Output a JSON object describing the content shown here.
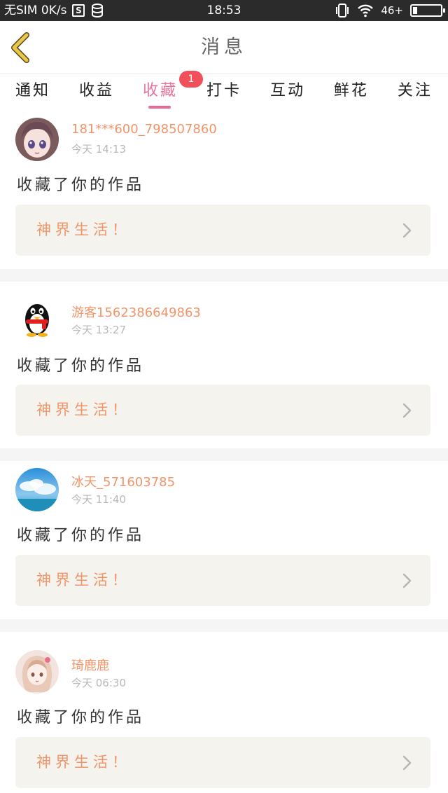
{
  "status_bar": {
    "carrier": "无SIM 0K/s",
    "time": "18:53",
    "network": "46+",
    "icons": [
      "sim-card-icon",
      "database-icon",
      "vibrate-icon",
      "wifi-icon",
      "battery-icon"
    ]
  },
  "header": {
    "title": "消息",
    "back_icon": "chevron-left-icon"
  },
  "tabs": [
    {
      "label": "通知",
      "active": false
    },
    {
      "label": "收益",
      "active": false
    },
    {
      "label": "收藏",
      "active": true,
      "badge": "1"
    },
    {
      "label": "打卡",
      "active": false
    },
    {
      "label": "互动",
      "active": false
    },
    {
      "label": "鲜花",
      "active": false
    },
    {
      "label": "关注",
      "active": false
    }
  ],
  "messages": [
    {
      "username": "181***600_798507860",
      "time": "今天 14:13",
      "action": "收藏了你的作品",
      "work_title": "神界生活！",
      "avatar": "anime-girl-avatar"
    },
    {
      "username": "游客1562386649863",
      "time": "今天 13:27",
      "action": "收藏了你的作品",
      "work_title": "神界生活！",
      "avatar": "penguin-avatar"
    },
    {
      "username": "冰天_571603785",
      "time": "今天 11:40",
      "action": "收藏了你的作品",
      "work_title": "神界生活！",
      "avatar": "sky-avatar"
    },
    {
      "username": "琦鹿鹿",
      "time": "今天 06:30",
      "action": "收藏了你的作品",
      "work_title": "神界生活！",
      "avatar": "sketch-girl-avatar"
    }
  ],
  "colors": {
    "accent": "#e8739a",
    "badge": "#f0505a",
    "username": "#f0956a",
    "back_arrow": "#e8c84a"
  }
}
